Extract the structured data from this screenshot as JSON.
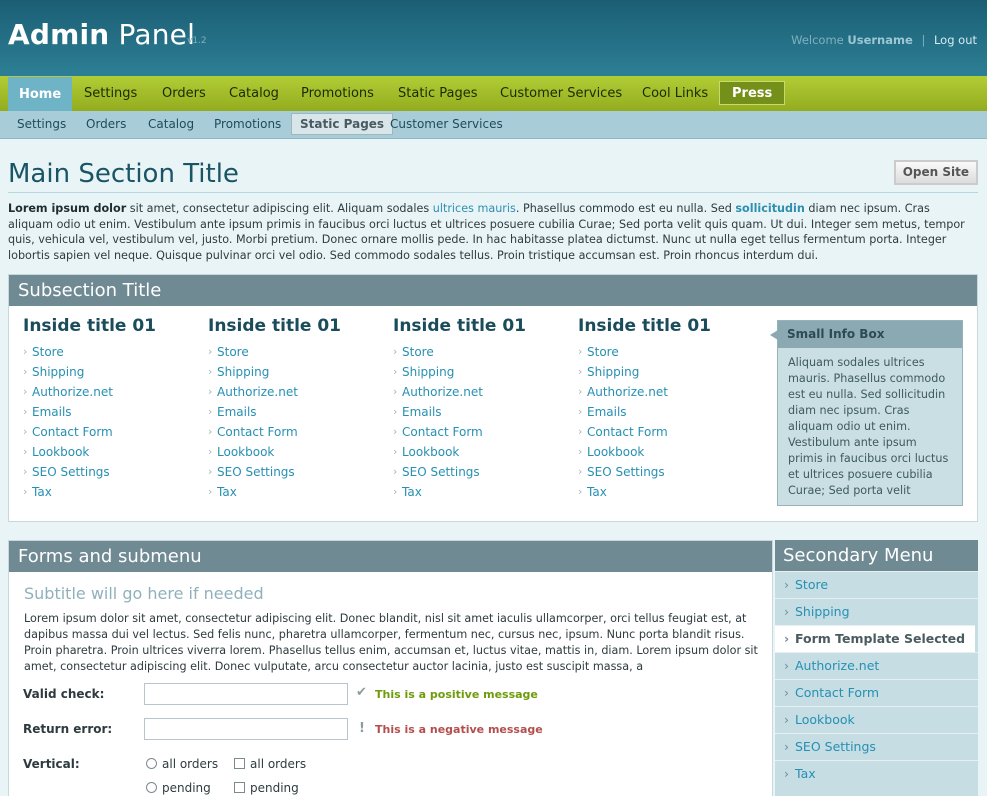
{
  "header": {
    "title_bold": "Admin",
    "title_light": "Panel",
    "version": "v1.2",
    "welcome": "Welcome",
    "username": "Username",
    "logout": "Log out"
  },
  "mainnav": [
    "Home",
    "Settings",
    "Orders",
    "Catalog",
    "Promotions",
    "Static Pages",
    "Customer Services",
    "Cool Links",
    "Press"
  ],
  "subnav": [
    "Settings",
    "Orders",
    "Catalog",
    "Promotions",
    "Static Pages",
    "Customer Services"
  ],
  "page": {
    "title": "Main Section Title",
    "open_site": "Open Site",
    "intro": {
      "lead": "Lorem ipsum dolor",
      "t1": " sit amet, consectetur adipiscing elit. Aliquam sodales ",
      "link1": "ultrices mauris",
      "t2": ". Phasellus commodo est eu nulla. Sed ",
      "link2": "sollicitudin",
      "t3": " diam nec ipsum. Cras aliquam odio ut enim. Vestibulum ante ipsum primis in faucibus orci luctus et ultrices posuere cubilia Curae; Sed porta velit quis quam. Ut dui. Integer sem metus, tempor quis, vehicula vel, vestibulum vel, justo. Morbi pretium. Donec ornare mollis pede. In hac habitasse platea dictumst. Nunc ut nulla eget tellus fermentum porta. Integer lobortis sapien vel neque. Quisque pulvinar orci vel odio. Sed commodo sodales tellus. Proin tristique accumsan est. Proin rhoncus interdum dui."
    }
  },
  "subsection": {
    "title": "Subsection Title",
    "columns": [
      {
        "title": "Inside title 01",
        "links": [
          "Store",
          "Shipping",
          "Authorize.net",
          "Emails",
          "Contact Form",
          "Lookbook",
          "SEO Settings",
          "Tax"
        ]
      },
      {
        "title": "Inside title 01",
        "links": [
          "Store",
          "Shipping",
          "Authorize.net",
          "Emails",
          "Contact Form",
          "Lookbook",
          "SEO Settings",
          "Tax"
        ]
      },
      {
        "title": "Inside title 01",
        "links": [
          "Store",
          "Shipping",
          "Authorize.net",
          "Emails",
          "Contact Form",
          "Lookbook",
          "SEO Settings",
          "Tax"
        ]
      },
      {
        "title": "Inside title 01",
        "links": [
          "Store",
          "Shipping",
          "Authorize.net",
          "Emails",
          "Contact Form",
          "Lookbook",
          "SEO Settings",
          "Tax"
        ]
      }
    ],
    "infobox": {
      "title": "Small Info Box",
      "text": "Aliquam sodales ultrices mauris. Phasellus commodo est eu nulla. Sed sollicitudin diam nec ipsum. Cras aliquam odio ut enim. Vestibulum ante ipsum primis in faucibus orci luctus et ultrices posuere cubilia Curae; Sed porta velit"
    }
  },
  "forms": {
    "title": "Forms and submenu",
    "subtitle": "Subtitle will go here if needed",
    "text": "Lorem ipsum dolor sit amet, consectetur adipiscing elit. Donec blandit, nisl sit amet iaculis ullamcorper, orci tellus feugiat est, at dapibus massa dui vel lectus. Sed felis nunc, pharetra ullamcorper, fermentum nec, cursus nec, ipsum. Nunc porta blandit risus. Proin pharetra. Proin ultrices viverra lorem. Phasellus tellus enim, accumsan et, luctus vitae, mattis in, diam. Lorem ipsum dolor sit amet, consectetur adipiscing elit. Donec vulputate, arcu consectetur auctor lacinia, justo est suscipit massa, a",
    "valid_label": "Valid check:",
    "valid_value": "",
    "positive_msg": "This is a positive message",
    "return_label": "Return error:",
    "return_value": "",
    "negative_msg": "This is a negative message",
    "vertical_label": "Vertical:",
    "radio_options": [
      "all orders",
      "pending"
    ],
    "checkbox_options": [
      "all orders",
      "pending"
    ]
  },
  "secondary_menu": {
    "title": "Secondary Menu",
    "items": [
      "Store",
      "Shipping",
      "Form Template Selected",
      "Authorize.net",
      "Contact Form",
      "Lookbook",
      "SEO Settings",
      "Tax"
    ]
  },
  "colors": {
    "header": "#1b5e74",
    "nav": "#a3bf2b",
    "accent": "#2690b3"
  }
}
